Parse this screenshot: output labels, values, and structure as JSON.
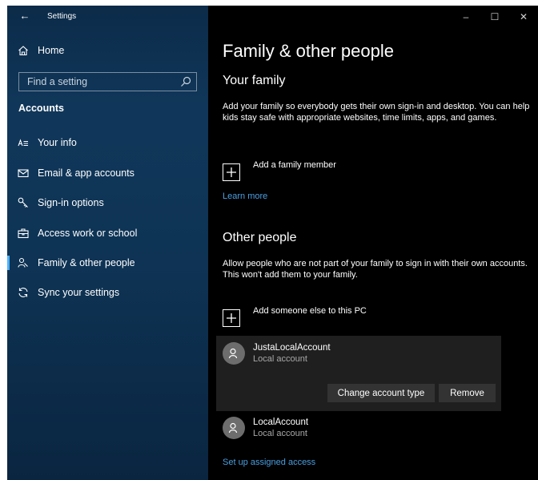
{
  "app": {
    "title": "Settings",
    "back_glyph": "←"
  },
  "window_controls": {
    "minimize": "–",
    "maximize": "☐",
    "close": "✕"
  },
  "sidebar": {
    "home_label": "Home",
    "search_placeholder": "Find a setting",
    "section_title": "Accounts",
    "items": [
      {
        "label": "Your info",
        "icon": "person-list-icon"
      },
      {
        "label": "Email & app accounts",
        "icon": "mail-icon"
      },
      {
        "label": "Sign-in options",
        "icon": "key-icon"
      },
      {
        "label": "Access work or school",
        "icon": "briefcase-icon"
      },
      {
        "label": "Family & other people",
        "icon": "people-icon",
        "active": true
      },
      {
        "label": "Sync your settings",
        "icon": "sync-icon"
      }
    ]
  },
  "main": {
    "page_title": "Family & other people",
    "your_family": {
      "heading": "Your family",
      "description": "Add your family so everybody gets their own sign-in and desktop. You can help kids stay safe with appropriate websites, time limits, apps, and games.",
      "add_label": "Add a family member",
      "learn_more": "Learn more"
    },
    "other_people": {
      "heading": "Other people",
      "description": "Allow people who are not part of your family to sign in with their own accounts. This won't add them to your family.",
      "add_label": "Add someone else to this PC"
    },
    "accounts": [
      {
        "name": "JustaLocalAccount",
        "type": "Local account",
        "expanded": true
      },
      {
        "name": "LocalAccount",
        "type": "Local account",
        "expanded": false
      }
    ],
    "buttons": {
      "change_type": "Change account type",
      "remove": "Remove"
    },
    "assigned_access_link": "Set up assigned access"
  },
  "colors": {
    "accent": "#4cb2ff",
    "link": "#4a9ee0",
    "sidebar_bg": "#10375a",
    "main_bg": "#000000",
    "card_bg": "#1f1f1f"
  }
}
